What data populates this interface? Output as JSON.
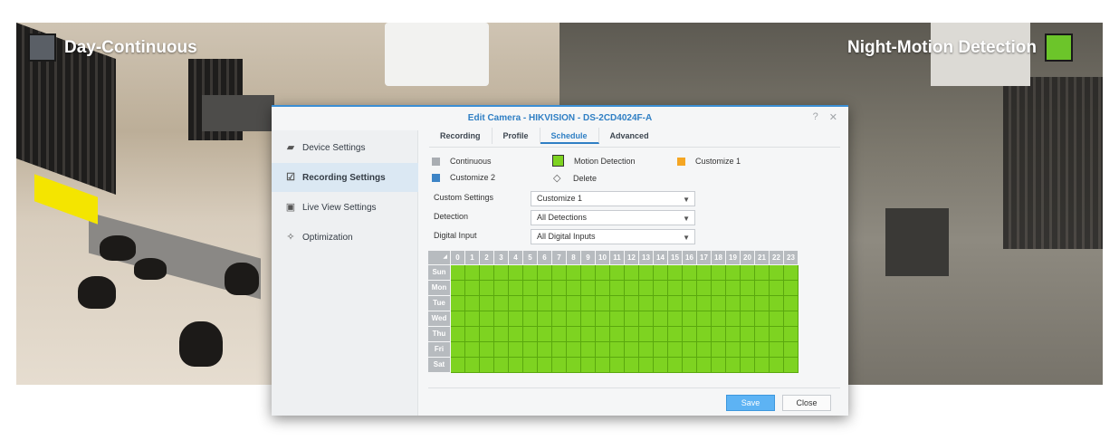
{
  "left_label": {
    "text": "Day-Continuous",
    "swatch_color": "#5a5f66"
  },
  "right_label": {
    "text": "Night-Motion Detection",
    "swatch_color": "#6cc52a"
  },
  "dialog": {
    "title": "Edit Camera - HIKVISION - DS-2CD4024F-A",
    "help_icon": "?",
    "close_icon": "✕"
  },
  "sidebar": {
    "items": [
      {
        "label": "Device Settings",
        "icon": "camera-icon"
      },
      {
        "label": "Recording Settings",
        "icon": "calendar-check-icon",
        "active": true
      },
      {
        "label": "Live View Settings",
        "icon": "live-view-icon"
      },
      {
        "label": "Optimization",
        "icon": "magic-wand-icon"
      }
    ]
  },
  "tabs": [
    {
      "label": "Recording"
    },
    {
      "label": "Profile"
    },
    {
      "label": "Schedule",
      "active": true
    },
    {
      "label": "Advanced"
    }
  ],
  "legend": {
    "continuous": {
      "label": "Continuous",
      "color": "#a9adb2"
    },
    "motion": {
      "label": "Motion Detection",
      "color": "#7ed321"
    },
    "customize1": {
      "label": "Customize 1",
      "color": "#f5a623"
    },
    "customize2": {
      "label": "Customize 2",
      "color": "#3d84c6"
    },
    "delete": {
      "label": "Delete"
    }
  },
  "fields": {
    "custom_settings": {
      "label": "Custom Settings",
      "value": "Customize 1"
    },
    "detection": {
      "label": "Detection",
      "value": "All Detections"
    },
    "digital_input": {
      "label": "Digital Input",
      "value": "All Digital Inputs"
    }
  },
  "schedule": {
    "corner": "◢",
    "hours": [
      "0",
      "1",
      "2",
      "3",
      "4",
      "5",
      "6",
      "7",
      "8",
      "9",
      "10",
      "11",
      "12",
      "13",
      "14",
      "15",
      "16",
      "17",
      "18",
      "19",
      "20",
      "21",
      "22",
      "23"
    ],
    "days": [
      "Sun",
      "Mon",
      "Tue",
      "Wed",
      "Thu",
      "Fri",
      "Sat"
    ],
    "fill_mode": "Motion Detection",
    "fill_color": "#7ed321"
  },
  "buttons": {
    "save": "Save",
    "close": "Close"
  }
}
